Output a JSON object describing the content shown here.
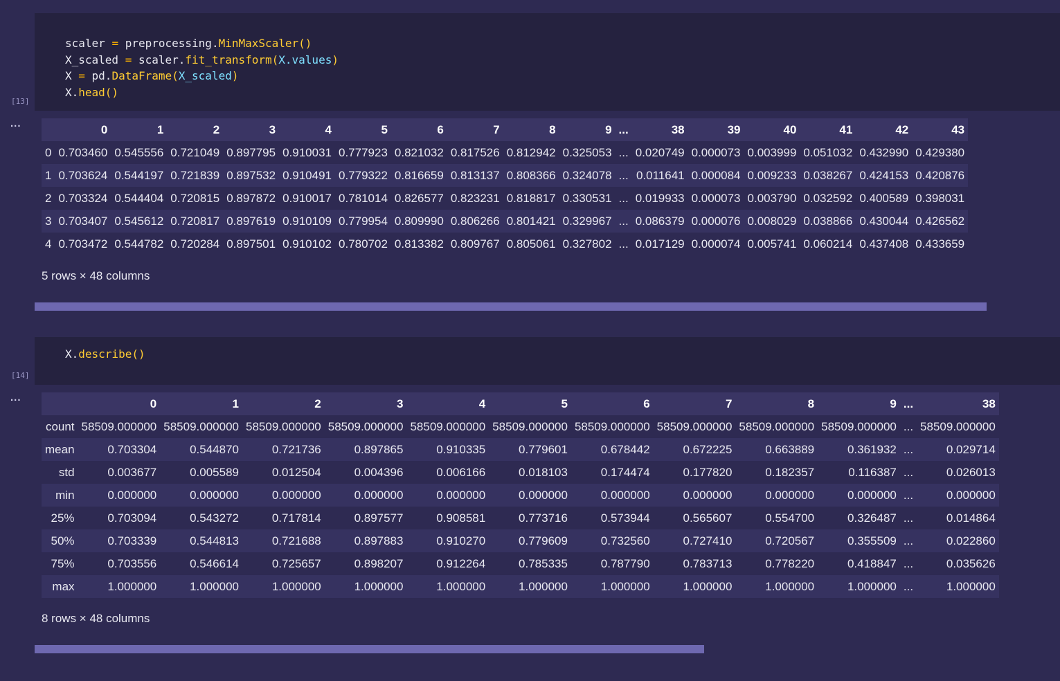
{
  "cells": [
    {
      "exec_count": "[13]",
      "code_lines": [
        [
          [
            "var",
            "scaler "
          ],
          [
            "op",
            "="
          ],
          [
            "var",
            " preprocessing."
          ],
          [
            "fn",
            "MinMaxScaler()"
          ]
        ],
        [
          [
            "var",
            "X_scaled "
          ],
          [
            "op",
            "="
          ],
          [
            "var",
            " scaler."
          ],
          [
            "fn",
            "fit_transform("
          ],
          [
            "arg",
            "X.values"
          ],
          [
            "fn",
            ")"
          ]
        ],
        [
          [
            "var",
            "X "
          ],
          [
            "op",
            "="
          ],
          [
            "var",
            " pd."
          ],
          [
            "fn",
            "DataFrame("
          ],
          [
            "arg",
            "X_scaled"
          ],
          [
            "fn",
            ")"
          ]
        ],
        [
          [
            "var",
            "X."
          ],
          [
            "fn",
            "head()"
          ]
        ]
      ],
      "output_menu": "...",
      "table": {
        "columns": [
          "",
          "0",
          "1",
          "2",
          "3",
          "4",
          "5",
          "6",
          "7",
          "8",
          "9",
          "...",
          "38",
          "39",
          "40",
          "41",
          "42",
          "43"
        ],
        "rows": [
          [
            "0",
            "0.703460",
            "0.545556",
            "0.721049",
            "0.897795",
            "0.910031",
            "0.777923",
            "0.821032",
            "0.817526",
            "0.812942",
            "0.325053",
            "...",
            "0.020749",
            "0.000073",
            "0.003999",
            "0.051032",
            "0.432990",
            "0.429380"
          ],
          [
            "1",
            "0.703624",
            "0.544197",
            "0.721839",
            "0.897532",
            "0.910491",
            "0.779322",
            "0.816659",
            "0.813137",
            "0.808366",
            "0.324078",
            "...",
            "0.011641",
            "0.000084",
            "0.009233",
            "0.038267",
            "0.424153",
            "0.420876"
          ],
          [
            "2",
            "0.703324",
            "0.544404",
            "0.720815",
            "0.897872",
            "0.910017",
            "0.781014",
            "0.826577",
            "0.823231",
            "0.818817",
            "0.330531",
            "...",
            "0.019933",
            "0.000073",
            "0.003790",
            "0.032592",
            "0.400589",
            "0.398031"
          ],
          [
            "3",
            "0.703407",
            "0.545612",
            "0.720817",
            "0.897619",
            "0.910109",
            "0.779954",
            "0.809990",
            "0.806266",
            "0.801421",
            "0.329967",
            "...",
            "0.086379",
            "0.000076",
            "0.008029",
            "0.038866",
            "0.430044",
            "0.426562"
          ],
          [
            "4",
            "0.703472",
            "0.544782",
            "0.720284",
            "0.897501",
            "0.910102",
            "0.780702",
            "0.813382",
            "0.809767",
            "0.805061",
            "0.327802",
            "...",
            "0.017129",
            "0.000074",
            "0.005741",
            "0.060214",
            "0.437408",
            "0.433659"
          ]
        ]
      },
      "shape_note": "5 rows × 48 columns"
    },
    {
      "exec_count": "[14]",
      "code_lines": [
        [
          [
            "var",
            "X."
          ],
          [
            "fn",
            "describe()"
          ]
        ]
      ],
      "output_menu": "...",
      "table": {
        "columns": [
          "",
          "0",
          "1",
          "2",
          "3",
          "4",
          "5",
          "6",
          "7",
          "8",
          "9",
          "...",
          "38"
        ],
        "rows": [
          [
            "count",
            "58509.000000",
            "58509.000000",
            "58509.000000",
            "58509.000000",
            "58509.000000",
            "58509.000000",
            "58509.000000",
            "58509.000000",
            "58509.000000",
            "58509.000000",
            "...",
            "58509.000000"
          ],
          [
            "mean",
            "0.703304",
            "0.544870",
            "0.721736",
            "0.897865",
            "0.910335",
            "0.779601",
            "0.678442",
            "0.672225",
            "0.663889",
            "0.361932",
            "...",
            "0.029714"
          ],
          [
            "std",
            "0.003677",
            "0.005589",
            "0.012504",
            "0.004396",
            "0.006166",
            "0.018103",
            "0.174474",
            "0.177820",
            "0.182357",
            "0.116387",
            "...",
            "0.026013"
          ],
          [
            "min",
            "0.000000",
            "0.000000",
            "0.000000",
            "0.000000",
            "0.000000",
            "0.000000",
            "0.000000",
            "0.000000",
            "0.000000",
            "0.000000",
            "...",
            "0.000000"
          ],
          [
            "25%",
            "0.703094",
            "0.543272",
            "0.717814",
            "0.897577",
            "0.908581",
            "0.773716",
            "0.573944",
            "0.565607",
            "0.554700",
            "0.326487",
            "...",
            "0.014864"
          ],
          [
            "50%",
            "0.703339",
            "0.544813",
            "0.721688",
            "0.897883",
            "0.910270",
            "0.779609",
            "0.732560",
            "0.727410",
            "0.720567",
            "0.355509",
            "...",
            "0.022860"
          ],
          [
            "75%",
            "0.703556",
            "0.546614",
            "0.725657",
            "0.898207",
            "0.912264",
            "0.785335",
            "0.787790",
            "0.783713",
            "0.778220",
            "0.418847",
            "...",
            "0.035626"
          ],
          [
            "max",
            "1.000000",
            "1.000000",
            "1.000000",
            "1.000000",
            "1.000000",
            "1.000000",
            "1.000000",
            "1.000000",
            "1.000000",
            "1.000000",
            "...",
            "1.000000"
          ]
        ]
      },
      "shape_note": "8 rows × 48 columns"
    }
  ]
}
